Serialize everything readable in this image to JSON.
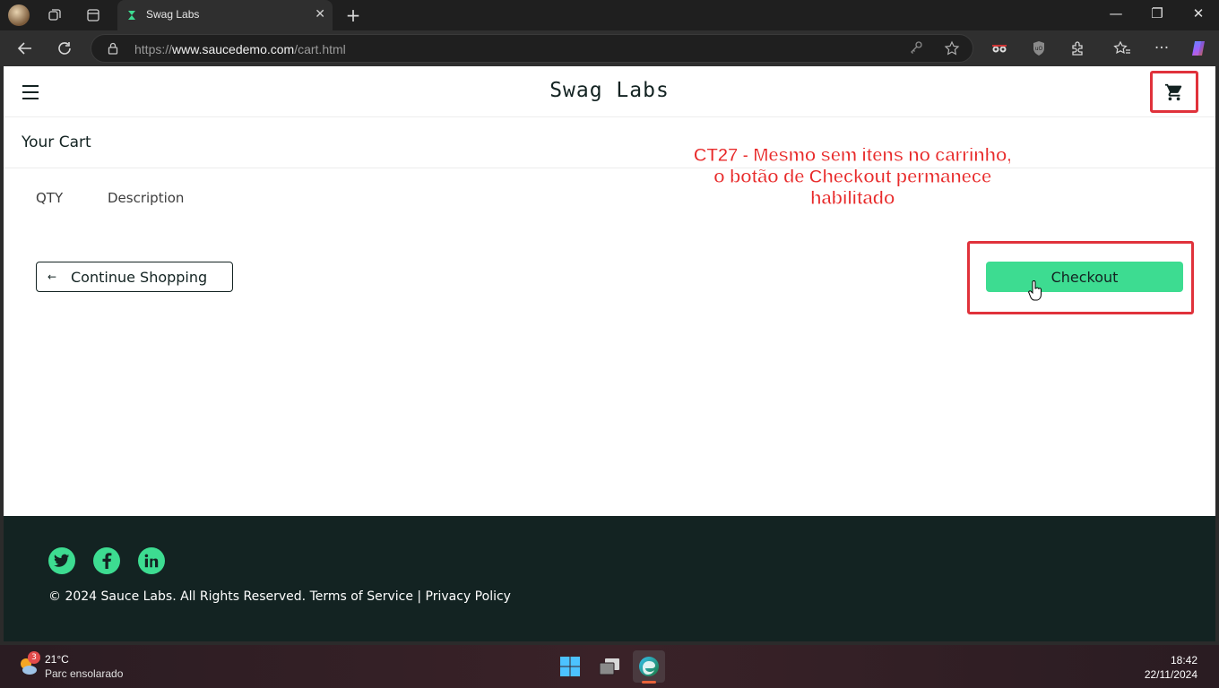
{
  "browser": {
    "tab_title": "Swag Labs",
    "url_prefix": "https://",
    "url_host": "www.saucedemo.com",
    "url_path": "/cart.html"
  },
  "app": {
    "logo": "Swag Labs",
    "section_title": "Your Cart",
    "columns": {
      "qty": "QTY",
      "description": "Description"
    },
    "continue_label": "Continue Shopping",
    "checkout_label": "Checkout",
    "annotation_lines": [
      "CT27 - Mesmo sem itens no carrinho,",
      "o botão de Checkout permanece",
      "habilitado"
    ],
    "footer_text": "© 2024 Sauce Labs. All Rights Reserved. Terms of Service | Privacy Policy",
    "social_icons": [
      "twitter-icon",
      "facebook-icon",
      "linkedin-icon"
    ]
  },
  "taskbar": {
    "weather_badge": "3",
    "temperature": "21°C",
    "condition": "Parc ensolarado",
    "time": "18:42",
    "date": "22/11/2024"
  },
  "colors": {
    "accent": "#3ddc91",
    "dark": "#132322",
    "highlight": "#e0323b"
  }
}
